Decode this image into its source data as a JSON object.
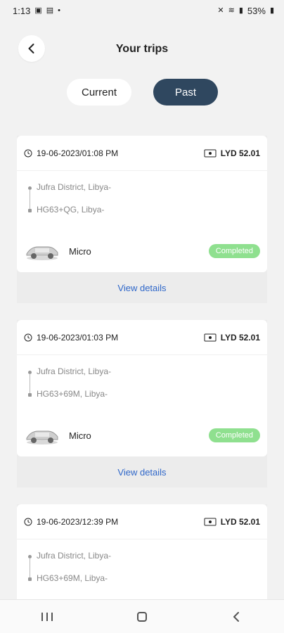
{
  "status": {
    "time": "1:13",
    "battery": "53%",
    "left_icons": [
      "gallery-icon",
      "app-icon",
      "dot-icon"
    ],
    "right_icons": [
      "mute-icon",
      "wifi-icon",
      "signal-icon",
      "battery-icon"
    ]
  },
  "header": {
    "title": "Your trips"
  },
  "tabs": [
    {
      "label": "Current"
    },
    {
      "label": "Past"
    }
  ],
  "colors": {
    "active_tab": "#2f475f",
    "badge": "#8fe08f",
    "link": "#2f67c9"
  },
  "trips": [
    {
      "datetime": "19-06-2023/01:08 PM",
      "fare": "LYD 52.01",
      "pickup": "Jufra District, Libya-",
      "drop": "HG63+QG, Libya-",
      "vehicle": "Micro",
      "status": "Completed",
      "details_label": "View details"
    },
    {
      "datetime": "19-06-2023/01:03 PM",
      "fare": "LYD 52.01",
      "pickup": "Jufra District, Libya-",
      "drop": "HG63+69M, Libya-",
      "vehicle": "Micro",
      "status": "Completed",
      "details_label": "View details"
    },
    {
      "datetime": "19-06-2023/12:39 PM",
      "fare": "LYD 52.01",
      "pickup": "Jufra District, Libya-",
      "drop": "HG63+69M, Libya-"
    }
  ]
}
